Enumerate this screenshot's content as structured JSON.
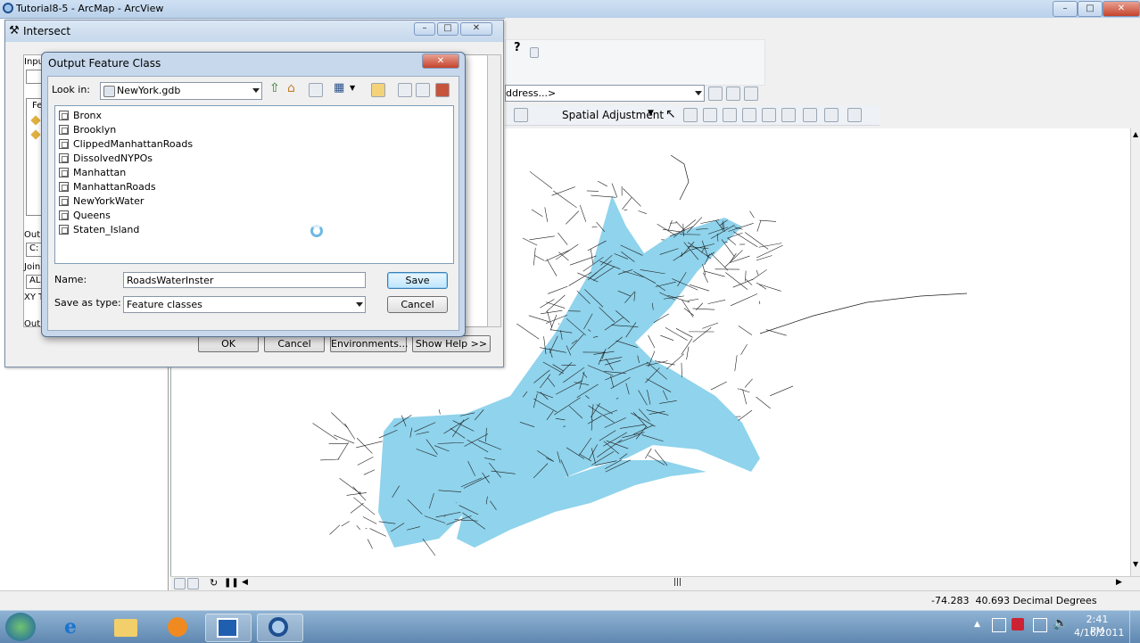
{
  "window": {
    "title": "Tutorial8-5 - ArcMap - ArcView"
  },
  "toolbars": {
    "address_combo": "ddress...>",
    "spatial_adjustment_label": "Spatial Adjustment",
    "help_label": "?"
  },
  "intersect_dialog": {
    "title": "Intersect",
    "field_fragments": [
      "Inpu",
      "Fe",
      "Outp",
      "C:",
      "Join",
      "ALL",
      "XY T",
      "Outp"
    ],
    "buttons": {
      "ok": "OK",
      "cancel": "Cancel",
      "environments": "Environments...",
      "show_help": "Show Help >>"
    }
  },
  "output_dialog": {
    "title": "Output Feature Class",
    "look_in_label": "Look in:",
    "look_in_value": "NewYork.gdb",
    "items": [
      {
        "name": "Bronx",
        "type": "polygon"
      },
      {
        "name": "Brooklyn",
        "type": "polygon"
      },
      {
        "name": "ClippedManhattanRoads",
        "type": "line"
      },
      {
        "name": "DissolvedNYPOs",
        "type": "polygon"
      },
      {
        "name": "Manhattan",
        "type": "polygon"
      },
      {
        "name": "ManhattanRoads",
        "type": "line"
      },
      {
        "name": "NewYorkWater",
        "type": "polygon"
      },
      {
        "name": "Queens",
        "type": "polygon"
      },
      {
        "name": "Staten_Island",
        "type": "polygon"
      }
    ],
    "name_label": "Name:",
    "name_value": "RoadsWaterInster",
    "save_as_type_label": "Save as type:",
    "save_as_type_value": "Feature classes",
    "save_button": "Save",
    "cancel_button": "Cancel"
  },
  "status": {
    "coordinates": "-74.283  40.693 Decimal Degrees"
  },
  "taskbar": {
    "time": "2:41 PM",
    "date": "4/16/2011",
    "apps": [
      "start",
      "internet-explorer",
      "windows-explorer",
      "media-player",
      "arccatalog",
      "arcmap"
    ]
  },
  "colors": {
    "water": "#8fd3ec",
    "roads": "#1e1e1e",
    "title_gradient": "#c6d8ec"
  }
}
